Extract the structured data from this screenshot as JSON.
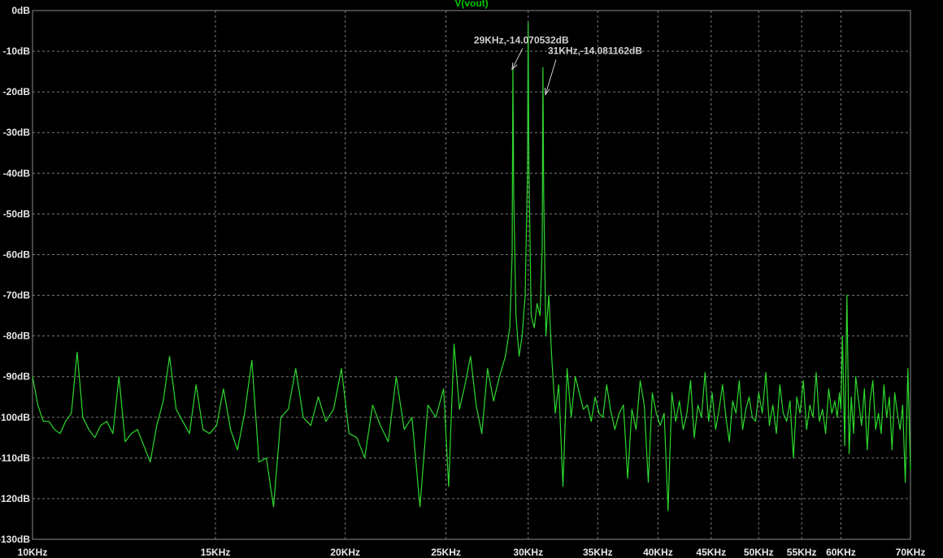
{
  "colors": {
    "background": "#000000",
    "trace": "#2dd82d",
    "title": "#00c800",
    "text": "#e8e8e8",
    "grid": "#7a7a7a"
  },
  "chart_data": {
    "type": "line",
    "title": "V(vout)",
    "xscale": "log",
    "xlim": [
      10000,
      70000
    ],
    "ylim": [
      -130,
      0
    ],
    "grid": true,
    "y_ticks": [
      0,
      -10,
      -20,
      -30,
      -40,
      -50,
      -60,
      -70,
      -80,
      -90,
      -100,
      -110,
      -120,
      -130
    ],
    "y_tick_labels": [
      "0dB",
      "-10dB",
      "-20dB",
      "-30dB",
      "-40dB",
      "-50dB",
      "-60dB",
      "-70dB",
      "-80dB",
      "-90dB",
      "-100dB",
      "-110dB",
      "-120dB",
      "-130dB"
    ],
    "x_ticks": [
      10000,
      15000,
      20000,
      25000,
      30000,
      35000,
      40000,
      45000,
      50000,
      55000,
      60000,
      70000
    ],
    "x_tick_labels": [
      "10KHz",
      "15KHz",
      "20KHz",
      "25KHz",
      "30KHz",
      "35KHz",
      "40KHz",
      "45KHz",
      "50KHz",
      "55KHz",
      "60KHz",
      "70KHz"
    ],
    "annotations": [
      {
        "text": "29KHz,-14.070532dB",
        "x": 29000,
        "y": -14.07
      },
      {
        "text": "31KHz,-14.081162dB",
        "x": 31000,
        "y": -14.08
      }
    ],
    "series": [
      {
        "x": [
          10000,
          10120,
          10240,
          10370,
          10500,
          10630,
          10760,
          10900,
          11040,
          11180,
          11330,
          11480,
          11630,
          11790,
          11950,
          12110,
          12280,
          12450,
          12620,
          12800,
          12980,
          13170,
          13360,
          13550,
          13750,
          13950,
          14160,
          14370,
          14590,
          14810,
          15040,
          15270,
          15510,
          15750,
          16000,
          16260,
          16520,
          16790,
          17060,
          17340,
          17630,
          17920,
          18220,
          18530,
          18840,
          19160,
          19490,
          19830,
          20170,
          20520,
          20880,
          21250,
          21620,
          22000,
          22390,
          22790,
          23190,
          23600,
          24020,
          24440,
          24870,
          25150,
          25450,
          25760,
          26080,
          26400,
          26730,
          27070,
          27420,
          27780,
          28150,
          28520,
          28800,
          28950,
          29000,
          29050,
          29200,
          29400,
          29600,
          29800,
          29950,
          30000,
          30050,
          30200,
          30400,
          30600,
          30800,
          30950,
          31000,
          31050,
          31200,
          31400,
          31600,
          31850,
          32100,
          32400,
          32700,
          33000,
          33300,
          33600,
          33900,
          34200,
          34500,
          34800,
          35100,
          35400,
          35700,
          36000,
          36350,
          36700,
          37050,
          37400,
          37750,
          38100,
          38450,
          38800,
          39150,
          39500,
          39850,
          40200,
          40550,
          40900,
          41250,
          41600,
          41950,
          42300,
          42650,
          43000,
          43350,
          43700,
          44050,
          44400,
          44750,
          45100,
          45450,
          45800,
          46150,
          46500,
          46850,
          47200,
          47550,
          47900,
          48250,
          48600,
          48950,
          49300,
          49650,
          50000,
          50400,
          50800,
          51200,
          51600,
          52000,
          52400,
          52800,
          53200,
          53600,
          54000,
          54400,
          54800,
          55200,
          55600,
          56000,
          56400,
          56800,
          57200,
          57600,
          58000,
          58400,
          58800,
          59200,
          59500,
          59800,
          60000,
          60200,
          60500,
          60800,
          61100,
          61400,
          61700,
          62000,
          62400,
          62800,
          63200,
          63600,
          64000,
          64400,
          64800,
          65200,
          65600,
          66000,
          66400,
          66800,
          67200,
          67600,
          68000,
          68400,
          68800,
          69200,
          69600,
          70000
        ],
        "y": [
          -90,
          -97,
          -101,
          -101,
          -103,
          -104,
          -101,
          -99,
          -84,
          -100,
          -103,
          -105,
          -102,
          -101,
          -104,
          -90,
          -106,
          -104,
          -103,
          -107,
          -111,
          -102,
          -96,
          -85,
          -98,
          -101,
          -104,
          -92,
          -103,
          -104,
          -102,
          -93,
          -103,
          -108,
          -99,
          -86,
          -111,
          -110,
          -122,
          -100,
          -98,
          -88,
          -100,
          -102,
          -95,
          -101,
          -98,
          -88,
          -104,
          -105,
          -110,
          -97,
          -102,
          -106,
          -90,
          -103,
          -100,
          -122,
          -97,
          -100,
          -93,
          -117,
          -82,
          -98,
          -92,
          -85,
          -97,
          -104,
          -88,
          -96,
          -90,
          -85,
          -78,
          -60,
          -14,
          -45,
          -75,
          -85,
          -80,
          -70,
          -40,
          -3,
          -40,
          -75,
          -78,
          -72,
          -75,
          -58,
          -14,
          -45,
          -80,
          -70,
          -85,
          -99,
          -92,
          -117,
          -88,
          -100,
          -90,
          -94,
          -98,
          -97,
          -101,
          -95,
          -99,
          -100,
          -92,
          -98,
          -103,
          -99,
          -97,
          -115,
          -98,
          -103,
          -91,
          -97,
          -116,
          -94,
          -99,
          -102,
          -99,
          -123,
          -94,
          -101,
          -96,
          -103,
          -99,
          -91,
          -105,
          -97,
          -100,
          -89,
          -101,
          -94,
          -103,
          -98,
          -92,
          -100,
          -106,
          -96,
          -99,
          -91,
          -103,
          -98,
          -95,
          -100,
          -101,
          -94,
          -99,
          -89,
          -102,
          -97,
          -104,
          -92,
          -99,
          -101,
          -96,
          -110,
          -95,
          -99,
          -91,
          -103,
          -97,
          -100,
          -89,
          -101,
          -98,
          -104,
          -93,
          -99,
          -96,
          -100,
          -94,
          -98,
          -80,
          -107,
          -70,
          -109,
          -95,
          -104,
          -90,
          -96,
          -102,
          -93,
          -108,
          -96,
          -91,
          -103,
          -99,
          -104,
          -92,
          -100,
          -95,
          -108,
          -94,
          -99,
          -103,
          -97,
          -116,
          -88,
          -113
        ]
      }
    ]
  }
}
